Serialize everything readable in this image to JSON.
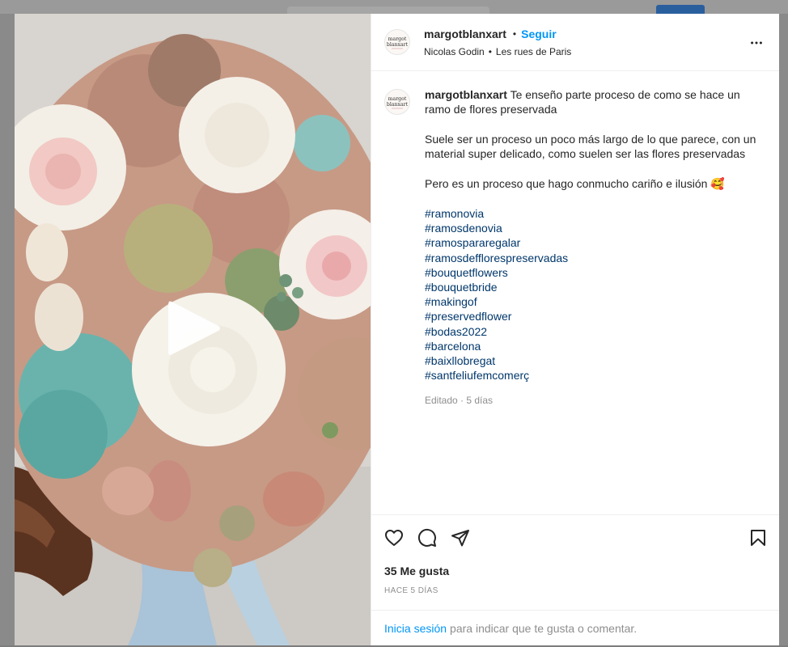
{
  "post": {
    "username": "margotblanxart",
    "avatar_text": "margot\nblanxart",
    "follow_label": "Seguir",
    "dot": "•",
    "audio": "Nicolas Godin",
    "location": "Les rues de Paris"
  },
  "caption": {
    "username": "margotblanxart",
    "line1": "Te enseño parte proceso de como se hace un ramo de flores preservada",
    "paragraph2": "Suele ser un proceso un poco más largo de lo que parece, con un material super delicado, como suelen ser las flores preservadas",
    "paragraph3": "Pero es un proceso que hago conmucho cariño e ilusión 🥰",
    "hashtags": [
      "#ramonovia",
      "#ramosdenovia",
      "#ramospararegalar",
      "#ramosdefflorespreservadas",
      "#bouquetflowers",
      "#bouquetbride",
      "#makingof",
      "#preservedflower",
      "#bodas2022",
      "#barcelona",
      "#baixllobregat",
      "#santfeliufemcomerç"
    ],
    "edited": "Editado · 5 días"
  },
  "engagement": {
    "likes": "35 Me gusta",
    "time_ago": "HACE 5 DÍAS"
  },
  "footer": {
    "login_link": "Inicia sesión",
    "login_text": "para indicar que te gusta o comentar."
  },
  "colors": {
    "accent": "#0095f6",
    "hashtag": "#00376b",
    "muted": "#8e8e8e"
  }
}
